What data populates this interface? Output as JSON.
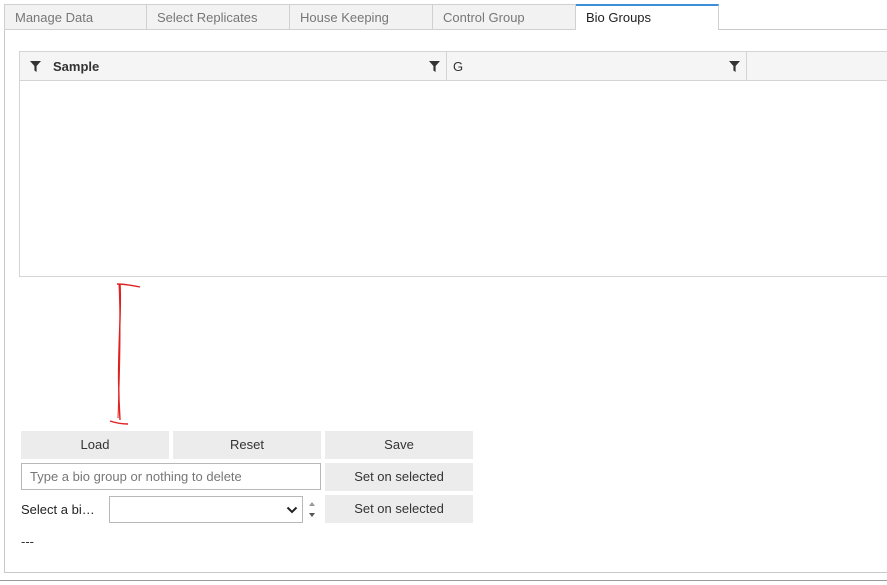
{
  "tabs": [
    {
      "label": "Manage Data"
    },
    {
      "label": "Select Replicates"
    },
    {
      "label": "House Keeping"
    },
    {
      "label": "Control Group"
    },
    {
      "label": "Bio Groups"
    }
  ],
  "active_tab": "Bio Groups",
  "grid": {
    "columns": [
      {
        "label": "Sample"
      },
      {
        "label": "G"
      }
    ]
  },
  "buttons": {
    "load": "Load",
    "reset": "Reset",
    "save": "Save",
    "set_on_selected_1": "Set on selected",
    "set_on_selected_2": "Set on selected"
  },
  "bio_input": {
    "placeholder": "Type a bio group or nothing to delete",
    "value": ""
  },
  "select": {
    "label": "Select a bi…",
    "value": ""
  },
  "status": "---",
  "colors": {
    "active_tab_accent": "#3a8fd8",
    "annotation": "#e02020"
  },
  "icons": {
    "column_filter": "funnel-icon",
    "select_arrow": "chevron-down-icon",
    "spinner": "spinner-arrows-icon"
  }
}
